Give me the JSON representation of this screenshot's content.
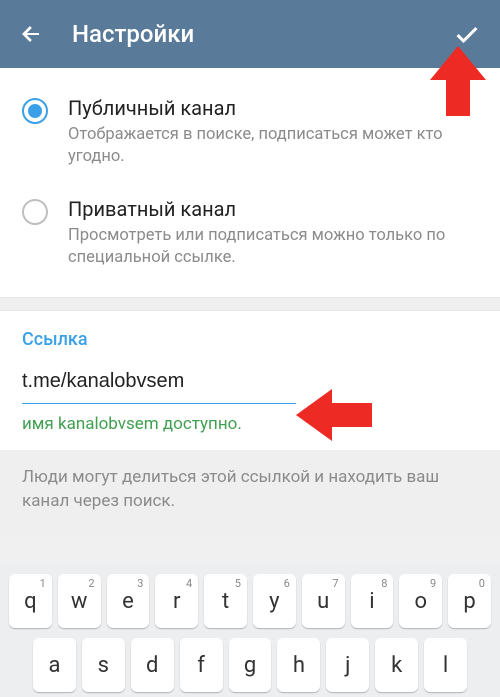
{
  "header": {
    "title": "Настройки"
  },
  "channelType": {
    "public": {
      "title": "Публичный канал",
      "desc": "Отображается в поиске, подписаться может кто угодно."
    },
    "private": {
      "title": "Приватный канал",
      "desc": "Просмотреть или подписаться можно только по специальной ссылке."
    }
  },
  "link": {
    "label": "Ссылка",
    "value": "t.me/kanalobvsem",
    "availability": "имя kanalobvsem доступно."
  },
  "hint": "Люди могут делиться этой ссылкой и находить ваш канал через поиск.",
  "keyboard": {
    "row1": [
      {
        "k": "q",
        "n": "1"
      },
      {
        "k": "w",
        "n": "2"
      },
      {
        "k": "e",
        "n": "3"
      },
      {
        "k": "r",
        "n": "4"
      },
      {
        "k": "t",
        "n": "5"
      },
      {
        "k": "y",
        "n": "6"
      },
      {
        "k": "u",
        "n": "7"
      },
      {
        "k": "i",
        "n": "8"
      },
      {
        "k": "o",
        "n": "9"
      },
      {
        "k": "p",
        "n": "0"
      }
    ],
    "row2": [
      {
        "k": "a"
      },
      {
        "k": "s"
      },
      {
        "k": "d"
      },
      {
        "k": "f"
      },
      {
        "k": "g"
      },
      {
        "k": "h"
      },
      {
        "k": "j"
      },
      {
        "k": "k"
      },
      {
        "k": "l"
      }
    ]
  }
}
